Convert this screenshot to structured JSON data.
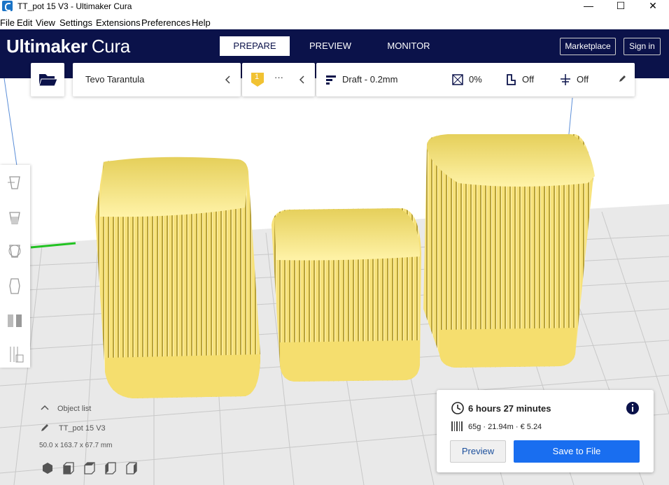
{
  "window": {
    "title": "TT_pot 15 V3 - Ultimaker Cura",
    "minimize": "—",
    "maximize": "☐",
    "close": "✕"
  },
  "menu": [
    "File",
    "Edit",
    "View",
    "Settings",
    "Extensions",
    "Preferences",
    "Help"
  ],
  "brand": {
    "primary": "Ultimaker",
    "secondary": "Cura"
  },
  "stages": [
    {
      "label": "PREPARE",
      "active": true
    },
    {
      "label": "PREVIEW",
      "active": false
    },
    {
      "label": "MONITOR",
      "active": false
    }
  ],
  "header_buttons": {
    "marketplace": "Marketplace",
    "signin": "Sign in"
  },
  "printer": {
    "name": "Tevo Tarantula"
  },
  "extruder": {
    "number": "1",
    "material": "···"
  },
  "print_settings": {
    "profile": "Draft - 0.2mm",
    "infill": "0%",
    "support": "Off",
    "adhesion": "Off"
  },
  "object_list": {
    "header": "Object list",
    "object_name": "TT_pot 15 V3",
    "dimensions": "50.0 x 163.7 x 67.7 mm"
  },
  "print_info": {
    "time": "6 hours 27 minutes",
    "material": "65g · 21.94m · € 5.24",
    "preview_label": "Preview",
    "save_label": "Save to File"
  },
  "colors": {
    "header_bg": "#0b124a",
    "accent_blue": "#196ef0",
    "model_yellow": "#f7e27a",
    "bed_grid": "#c8c8c8"
  }
}
